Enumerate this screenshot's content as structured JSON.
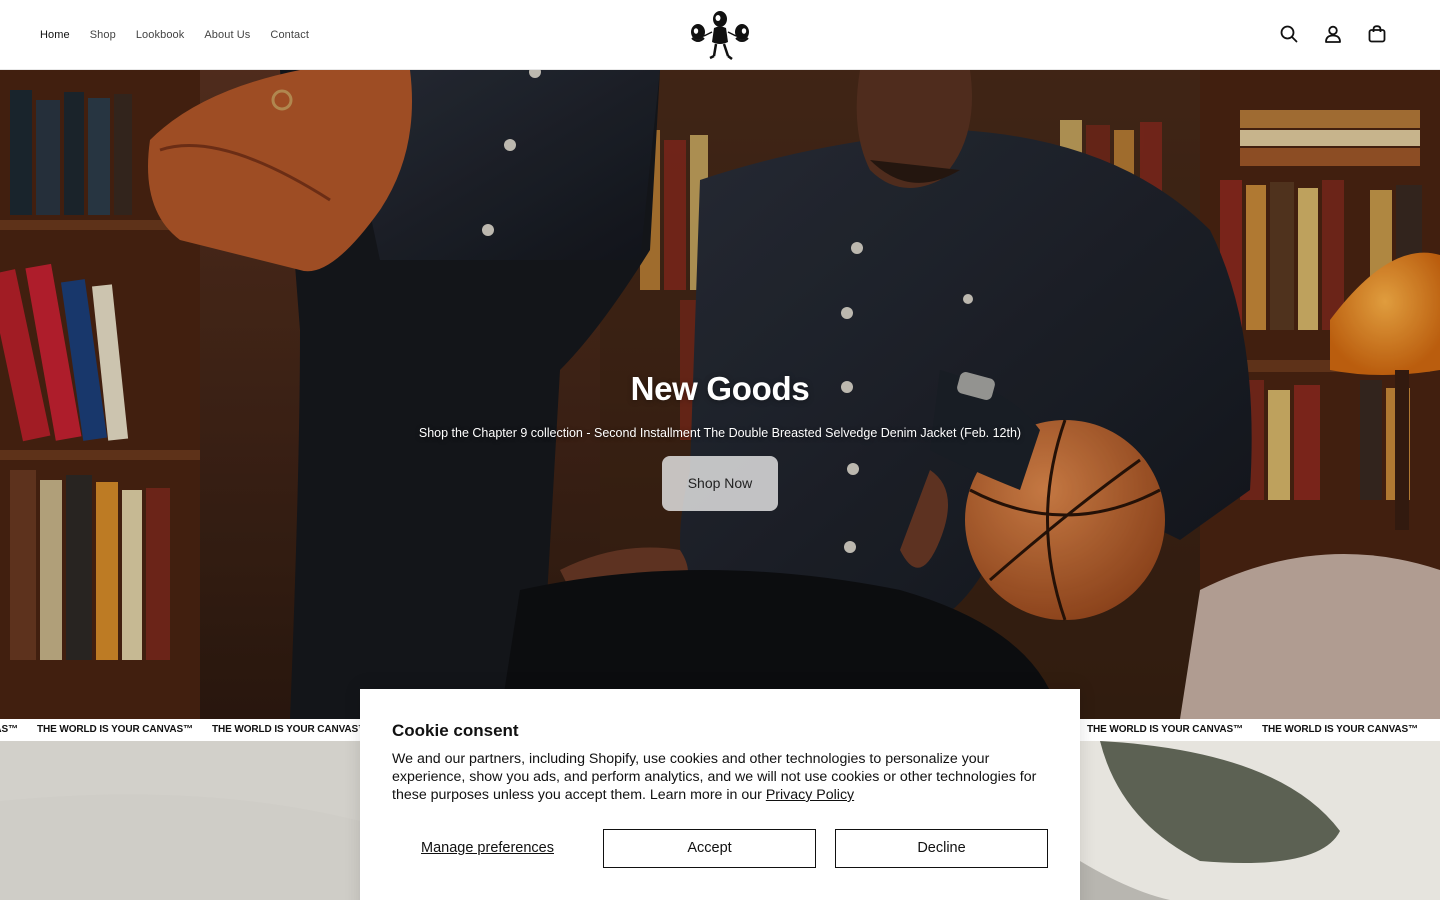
{
  "nav": {
    "items": [
      {
        "label": "Home",
        "active": true
      },
      {
        "label": "Shop"
      },
      {
        "label": "Lookbook"
      },
      {
        "label": "About Us"
      },
      {
        "label": "Contact"
      }
    ]
  },
  "header_icons": [
    "search-icon",
    "account-icon",
    "cart-icon"
  ],
  "hero": {
    "title": "New Goods",
    "subtitle": "Shop the Chapter 9 collection - Second Installment The Double Breasted Selvedge Denim Jacket (Feb. 12th)",
    "button_label": "Shop Now"
  },
  "marquee": {
    "text": "THE WORLD IS YOUR CANVAS™"
  },
  "cookie": {
    "title": "Cookie consent",
    "body": "We and our partners, including Shopify, use cookies and other technologies to personalize your experience, show you ads, and perform analytics, and we will not use cookies or other technologies for these purposes unless you accept them. Learn more in our ",
    "link_label": "Privacy Policy",
    "manage_label": "Manage preferences",
    "accept_label": "Accept",
    "decline_label": "Decline"
  },
  "colors": {
    "accent": "#111111",
    "hero_button_bg": "#e6e6e6"
  }
}
